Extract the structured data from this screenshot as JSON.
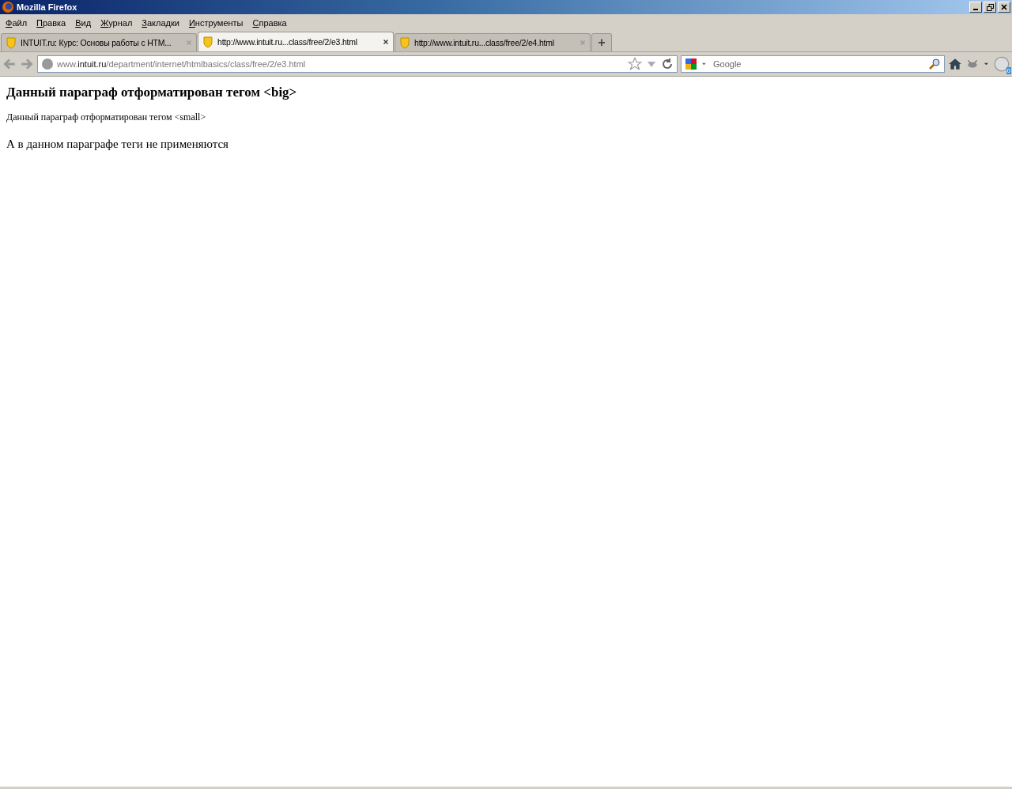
{
  "window": {
    "title": "Mozilla Firefox"
  },
  "menu": [
    "Файл",
    "Правка",
    "Вид",
    "Журнал",
    "Закладки",
    "Инструменты",
    "Справка"
  ],
  "tabs": [
    {
      "label": "INTUIT.ru: Курс: Основы работы с HTM...",
      "selected": false
    },
    {
      "label": "http://www.intuit.ru...class/free/2/e3.html",
      "selected": true
    },
    {
      "label": "http://www.intuit.ru...class/free/2/e4.html",
      "selected": false
    }
  ],
  "new_tab": "+",
  "address": {
    "prefix": "www.",
    "domain": "intuit.ru",
    "path": "/department/internet/htmlbasics/class/free/2/e3.html"
  },
  "search": {
    "placeholder": "Google"
  },
  "badge": "0",
  "content": [
    {
      "kind": "big",
      "text": "Данный параграф отформатирован тегом <big>"
    },
    {
      "kind": "small",
      "text": "Данный параграф отформатирован тегом <small>"
    },
    {
      "kind": "normal",
      "text": "А в данном параграфе теги не применяются"
    }
  ]
}
